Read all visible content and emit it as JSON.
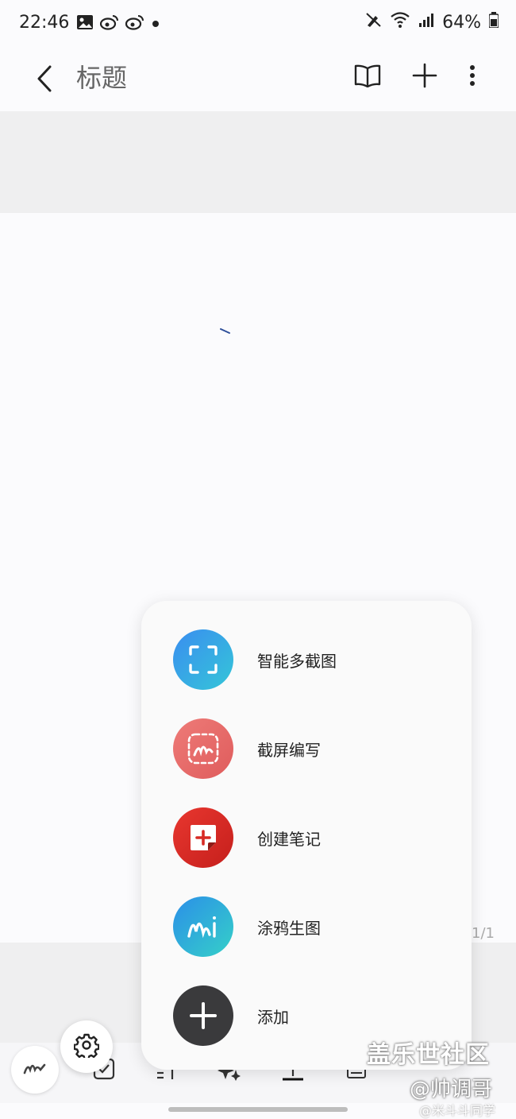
{
  "status_bar": {
    "time": "22:46",
    "left_icons": [
      "image-icon",
      "weibo-icon",
      "weibo-icon",
      "dot-icon"
    ],
    "right_icons": [
      "pen-off-icon",
      "wifi-icon",
      "signal-icon",
      "battery-icon"
    ],
    "battery": "64%"
  },
  "app_bar": {
    "title": "标题",
    "actions": [
      "book-icon",
      "plus-icon",
      "more-vertical-icon"
    ]
  },
  "page_indicator": "1/1",
  "menu": {
    "items": [
      {
        "label": "智能多截图",
        "icon": "smart-capture-icon",
        "color": "#3aa0f0"
      },
      {
        "label": "截屏编写",
        "icon": "screen-write-icon",
        "color": "#e6736e"
      },
      {
        "label": "创建笔记",
        "icon": "create-note-icon",
        "color": "#e0302a"
      },
      {
        "label": "涂鸦生图",
        "icon": "doodle-ai-icon",
        "color": "#2fb6e6"
      },
      {
        "label": "添加",
        "icon": "plus-icon",
        "color": "#3a3a3c"
      }
    ]
  },
  "toolbar": {
    "tools": [
      "pen-icon",
      "checkbox-icon",
      "text-icon",
      "ai-sparkle-icon",
      "text-underline-icon",
      "image-icon"
    ],
    "settings_icon": "gear-icon"
  },
  "watermark": {
    "community": "盖乐世社区",
    "author": "@帅调哥",
    "weibo": "@米斗斗同学"
  }
}
